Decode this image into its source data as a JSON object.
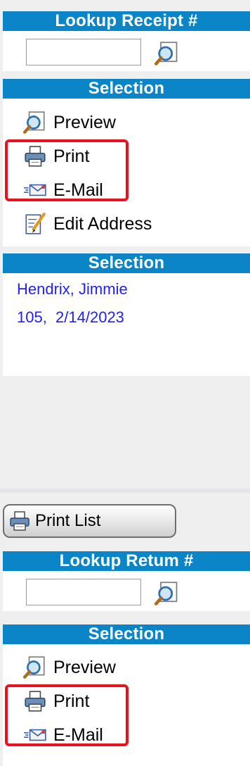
{
  "receipt_lookup": {
    "title": "Lookup Receipt #",
    "input_value": "",
    "search_icon": "magnifier-icon"
  },
  "selection_actions": {
    "title": "Selection",
    "items": [
      {
        "label": "Preview",
        "icon": "preview-magnifier-icon"
      },
      {
        "label": "Print",
        "icon": "printer-icon"
      },
      {
        "label": "E-Mail",
        "icon": "email-icon"
      },
      {
        "label": "Edit Address",
        "icon": "edit-pencil-icon"
      }
    ]
  },
  "selection_info": {
    "title": "Selection",
    "customer_name": "Hendrix, Jimmie",
    "receipt_line": "105,  2/14/2023"
  },
  "print_list": {
    "label": "Print List",
    "icon": "printer-icon"
  },
  "return_lookup": {
    "title": "Lookup Retum #",
    "input_value": "",
    "search_icon": "magnifier-icon"
  },
  "return_actions": {
    "title": "Selection",
    "items": [
      {
        "label": "Preview",
        "icon": "preview-magnifier-icon"
      },
      {
        "label": "Print",
        "icon": "printer-icon"
      },
      {
        "label": "E-Mail",
        "icon": "email-icon"
      }
    ]
  },
  "colors": {
    "header_bg": "#0a86c8",
    "link_text": "#1f1fff",
    "highlight_border": "#e8131f"
  }
}
